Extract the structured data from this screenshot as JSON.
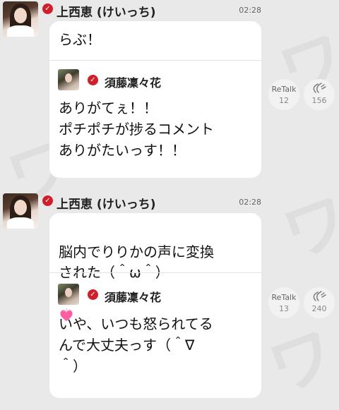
{
  "posts": [
    {
      "author": "上西恵 (けいっち)",
      "time": "02:28",
      "message": "らぶ！",
      "reply": {
        "author": "須藤凜々花",
        "text": "ありがてぇ！！\nポチポチが捗るコメント\nありがたいっす！！"
      },
      "retalk_label": "ReTalk",
      "retalk_count": "12",
      "clap_count": "156"
    },
    {
      "author": "上西恵 (けいっち)",
      "time": "02:28",
      "message": "脳内でりりかの声に変換\nされた（＾ω＾）",
      "reply": {
        "author": "須藤凜々花",
        "text": "いや、いつも怒られてる\nんで大丈夫っす（＾∇\n＾）"
      },
      "retalk_label": "ReTalk",
      "retalk_count": "13",
      "clap_count": "240"
    }
  ],
  "colors": {
    "background": "#e9e9e9",
    "bubble": "#ffffff",
    "verified_badge": "#d11e2a",
    "heart": "#ff5fa2"
  },
  "icons": {
    "verified": "verified-check-icon",
    "clap": "clap-hands-icon",
    "heart": "pink-heart-icon"
  }
}
